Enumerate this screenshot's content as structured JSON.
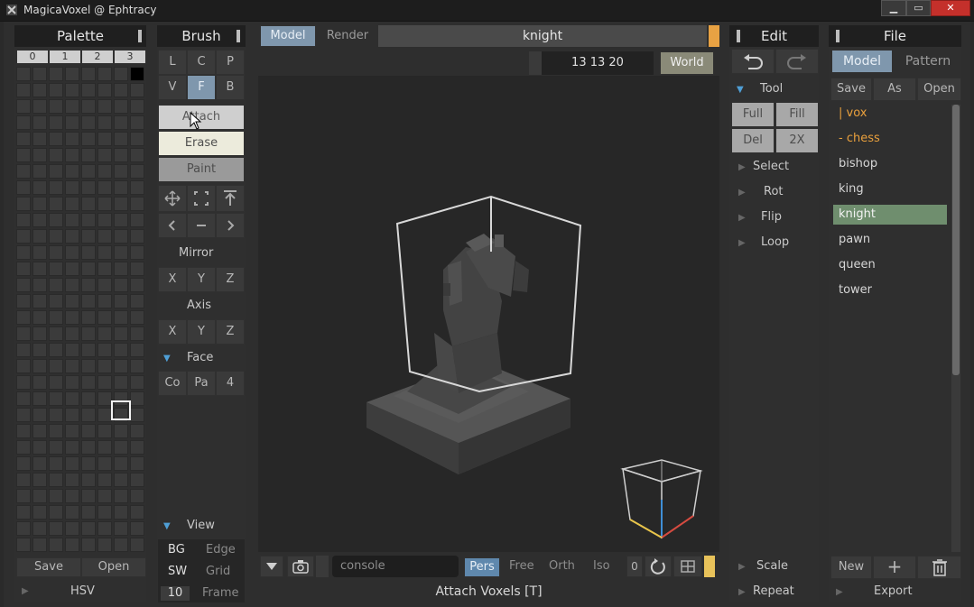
{
  "window": {
    "title": "MagicaVoxel @ Ephtracy"
  },
  "palette": {
    "title": "Palette",
    "tabs": [
      "0",
      "1",
      "2",
      "3"
    ],
    "save_label": "Save",
    "open_label": "Open",
    "hsv_label": "HSV"
  },
  "brush": {
    "title": "Brush",
    "row1": [
      "L",
      "C",
      "P"
    ],
    "row2": [
      "V",
      "F",
      "B"
    ],
    "attach_label": "Attach",
    "erase_label": "Erase",
    "paint_label": "Paint",
    "mirror_label": "Mirror",
    "mirror": [
      "X",
      "Y",
      "Z"
    ],
    "axis_label": "Axis",
    "axis": [
      "X",
      "Y",
      "Z"
    ],
    "face_label": "Face",
    "face": [
      "Co",
      "Pa",
      "4"
    ],
    "view_label": "View",
    "view_rows": [
      {
        "key": "BG",
        "value": "Edge"
      },
      {
        "key": "SW",
        "value": "Grid"
      },
      {
        "key": "10",
        "value": "Frame"
      }
    ]
  },
  "topbar": {
    "model_tab": "Model",
    "render_tab": "Render",
    "file_name": "knight",
    "dims": "13 13 20",
    "world_label": "World"
  },
  "bottombar": {
    "console_placeholder": "console",
    "modes": [
      "Pers",
      "Free",
      "Orth",
      "Iso"
    ],
    "zero": "0",
    "status": "Attach Voxels [T]"
  },
  "edit": {
    "title": "Edit",
    "tool_label": "Tool",
    "tool_buttons": [
      "Full",
      "Fill",
      "Del",
      "2X"
    ],
    "sections": [
      "Select",
      "Rot",
      "Flip",
      "Loop"
    ],
    "scale_label": "Scale",
    "repeat_label": "Repeat"
  },
  "file": {
    "title": "File",
    "model_tab": "Model",
    "pattern_tab": "Pattern",
    "save_label": "Save",
    "as_label": "As",
    "open_label": "Open",
    "items": [
      {
        "label": "| vox",
        "kind": "folder"
      },
      {
        "label": "- chess",
        "kind": "folder"
      },
      {
        "label": "bishop",
        "kind": "file"
      },
      {
        "label": "king",
        "kind": "file"
      },
      {
        "label": "knight",
        "kind": "selected"
      },
      {
        "label": "pawn",
        "kind": "file"
      },
      {
        "label": "queen",
        "kind": "file"
      },
      {
        "label": "tower",
        "kind": "file"
      }
    ],
    "new_label": "New",
    "plus_label": "+",
    "export_label": "Export"
  }
}
